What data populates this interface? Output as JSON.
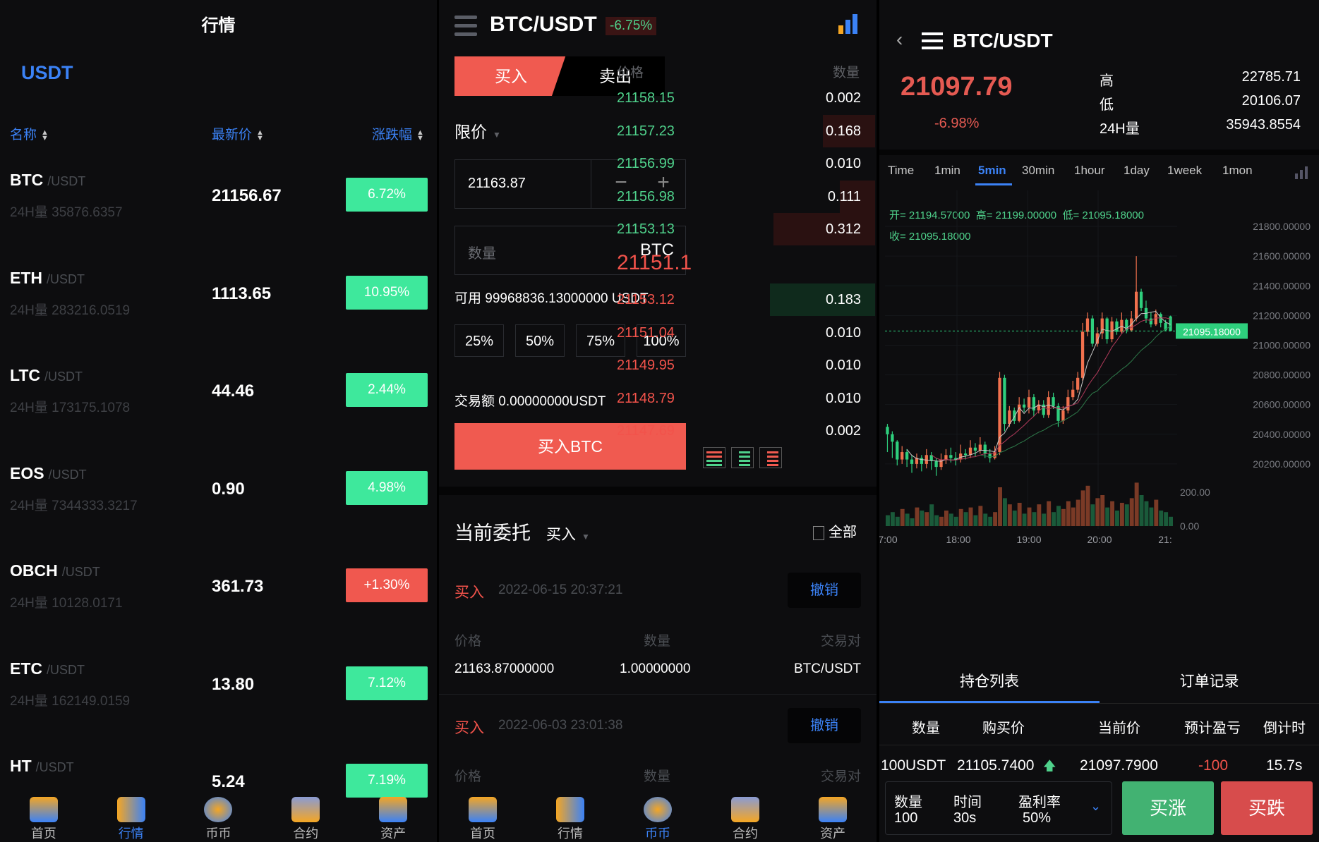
{
  "market": {
    "title": "行情",
    "quote_tab": "USDT",
    "headers": {
      "name": "名称",
      "price": "最新价",
      "change": "涨跌幅"
    },
    "rows": [
      {
        "sym": "BTC",
        "quote": "/USDT",
        "vol": "24H量 35876.6357",
        "price": "21156.67",
        "chg": "6.72%",
        "up": true
      },
      {
        "sym": "ETH",
        "quote": "/USDT",
        "vol": "24H量 283216.0519",
        "price": "1113.65",
        "chg": "10.95%",
        "up": true
      },
      {
        "sym": "LTC",
        "quote": "/USDT",
        "vol": "24H量 173175.1078",
        "price": "44.46",
        "chg": "2.44%",
        "up": true
      },
      {
        "sym": "EOS",
        "quote": "/USDT",
        "vol": "24H量 7344333.3217",
        "price": "0.90",
        "chg": "4.98%",
        "up": true
      },
      {
        "sym": "OBCH",
        "quote": "/USDT",
        "vol": "24H量 10128.0171",
        "price": "361.73",
        "chg": "+1.30%",
        "up": false
      },
      {
        "sym": "ETC",
        "quote": "/USDT",
        "vol": "24H量 162149.0159",
        "price": "13.80",
        "chg": "7.12%",
        "up": true
      },
      {
        "sym": "HT",
        "quote": "/USDT",
        "vol": "",
        "price": "5.24",
        "chg": "7.19%",
        "up": true
      }
    ]
  },
  "nav": {
    "home": "首页",
    "market": "行情",
    "coin": "币币",
    "contract": "合约",
    "assets": "资产"
  },
  "trade": {
    "pair": "BTC/USDT",
    "change": "-6.75%",
    "buy_tab": "买入",
    "sell_tab": "卖出",
    "order_type": "限价",
    "price_value": "21163.87",
    "qty_placeholder": "数量",
    "qty_unit": "BTC",
    "available": "可用 99968836.13000000 USDT",
    "pct": [
      "25%",
      "50%",
      "75%",
      "100%"
    ],
    "amount": "交易额 0.00000000USDT",
    "submit": "买入BTC",
    "ob_header": {
      "price": "价格",
      "qty": "数量"
    },
    "asks": [
      {
        "p": "21158.15",
        "q": "0.002",
        "depth": 0.0
      },
      {
        "p": "21157.23",
        "q": "0.168",
        "depth": 0.49
      },
      {
        "p": "21156.99",
        "q": "0.010",
        "depth": 0.0
      },
      {
        "p": "21156.98",
        "q": "0.111",
        "depth": 0.33
      },
      {
        "p": "21153.13",
        "q": "0.312",
        "depth": 0.95
      }
    ],
    "last": "21151.1",
    "bids": [
      {
        "p": "21153.12",
        "q": "0.183",
        "depth": 0.98
      },
      {
        "p": "21151.04",
        "q": "0.010",
        "depth": 0.0
      },
      {
        "p": "21149.95",
        "q": "0.010",
        "depth": 0.0
      },
      {
        "p": "21148.79",
        "q": "0.010",
        "depth": 0.0
      },
      {
        "p": "21147.69",
        "q": "0.002",
        "depth": 0.0
      }
    ],
    "orders_title": "当前委托",
    "orders_filter": "买入",
    "orders_all": "全部",
    "orders": [
      {
        "side": "买入",
        "time": "2022-06-15 20:37:21",
        "cancel": "撤销",
        "h_price": "价格",
        "h_qty": "数量",
        "h_pair": "交易对",
        "price": "21163.87000000",
        "qty": "1.00000000",
        "pair": "BTC/USDT"
      },
      {
        "side": "买入",
        "time": "2022-06-03 23:01:38",
        "cancel": "撤销",
        "h_price": "价格",
        "h_qty": "数量",
        "h_pair": "交易对"
      }
    ]
  },
  "chart": {
    "pair": "BTC/USDT",
    "price": "21097.79",
    "change": "-6.98%",
    "stats": {
      "high_l": "高",
      "high": "22785.71",
      "low_l": "低",
      "low": "20106.07",
      "vol_l": "24H量",
      "vol": "35943.8554"
    },
    "timeframes": [
      "Time",
      "1min",
      "5min",
      "30min",
      "1hour",
      "1day",
      "1week",
      "1mon"
    ],
    "active_tf": "5min",
    "ohlc_line1": "开= 21194.57000  高= 21199.00000  低= 21095.18000",
    "ohlc_line2": "收= 21095.18000",
    "current_label": "21095.18000",
    "tabs": {
      "positions": "持仓列表",
      "orders": "订单记录"
    },
    "pos_headers": {
      "qty": "数量",
      "buy": "购买价",
      "cur": "当前价",
      "pnl": "预计盈亏",
      "cd": "倒计时"
    },
    "pos_row": {
      "qty": "100USDT",
      "buy": "21105.7400",
      "cur": "21097.7900",
      "pnl": "-100",
      "cd": "15.7s"
    },
    "bottom": {
      "qty_l": "数量",
      "qty": "100",
      "time_l": "时间",
      "time": "30s",
      "rate_l": "盈利率",
      "rate": "50%",
      "up_btn": "买涨",
      "down_btn": "买跌"
    }
  },
  "chart_data": {
    "type": "candlestick",
    "y_ticks": [
      "21800.00000",
      "21600.00000",
      "21400.00000",
      "21200.00000",
      "21000.00000",
      "20800.00000",
      "20600.00000",
      "20400.00000",
      "20200.00000"
    ],
    "vol_ticks": [
      "200.00",
      "0.00"
    ],
    "x_ticks": [
      "7:00",
      "18:00",
      "19:00",
      "20:00",
      "21:"
    ],
    "ylim": [
      20000,
      21900
    ],
    "vol_max": 300,
    "candles": [
      [
        20450,
        20400,
        20470,
        20280
      ],
      [
        20400,
        20350,
        20420,
        20240
      ],
      [
        20350,
        20230,
        20360,
        20190
      ],
      [
        20230,
        20280,
        20320,
        20200
      ],
      [
        20280,
        20230,
        20300,
        20180
      ],
      [
        20230,
        20200,
        20260,
        20140
      ],
      [
        20200,
        20240,
        20270,
        20170
      ],
      [
        20240,
        20200,
        20260,
        20150
      ],
      [
        20200,
        20260,
        20300,
        20170
      ],
      [
        20260,
        20220,
        20280,
        20160
      ],
      [
        20220,
        20180,
        20240,
        20120
      ],
      [
        20180,
        20230,
        20270,
        20160
      ],
      [
        20230,
        20260,
        20300,
        20200
      ],
      [
        20260,
        20240,
        20310,
        20210
      ],
      [
        20240,
        20230,
        20280,
        20190
      ],
      [
        20230,
        20270,
        20330,
        20210
      ],
      [
        20270,
        20260,
        20300,
        20230
      ],
      [
        20260,
        20310,
        20360,
        20240
      ],
      [
        20310,
        20290,
        20340,
        20250
      ],
      [
        20290,
        20330,
        20380,
        20270
      ],
      [
        20330,
        20270,
        20350,
        20240
      ],
      [
        20270,
        20240,
        20300,
        20210
      ],
      [
        20240,
        20280,
        20320,
        20230
      ],
      [
        20280,
        20780,
        20820,
        20260
      ],
      [
        20780,
        20470,
        20800,
        20420
      ],
      [
        20470,
        20560,
        20590,
        20450
      ],
      [
        20560,
        20490,
        20580,
        20470
      ],
      [
        20490,
        20600,
        20650,
        20480
      ],
      [
        20600,
        20580,
        20640,
        20550
      ],
      [
        20580,
        20650,
        20700,
        20540
      ],
      [
        20650,
        20560,
        20670,
        20520
      ],
      [
        20560,
        20600,
        20630,
        20540
      ],
      [
        20600,
        20530,
        20630,
        20510
      ],
      [
        20530,
        20650,
        20690,
        20510
      ],
      [
        20650,
        20590,
        20680,
        20570
      ],
      [
        20590,
        20490,
        20610,
        20450
      ],
      [
        20490,
        20560,
        20590,
        20470
      ],
      [
        20560,
        20650,
        20700,
        20540
      ],
      [
        20650,
        20700,
        20760,
        20630
      ],
      [
        20700,
        20780,
        20820,
        20680
      ],
      [
        20780,
        21090,
        21150,
        20760
      ],
      [
        21090,
        21180,
        21220,
        21060
      ],
      [
        21180,
        21010,
        21200,
        20990
      ],
      [
        21010,
        21080,
        21120,
        20990
      ],
      [
        21080,
        21180,
        21220,
        21040
      ],
      [
        21180,
        21040,
        21190,
        21010
      ],
      [
        21040,
        21160,
        21190,
        21020
      ],
      [
        21160,
        21090,
        21180,
        21070
      ],
      [
        21090,
        21170,
        21220,
        21080
      ],
      [
        21170,
        21100,
        21180,
        21080
      ],
      [
        21100,
        21180,
        21230,
        21090
      ],
      [
        21180,
        21360,
        21600,
        21160
      ],
      [
        21360,
        21250,
        21380,
        21230
      ],
      [
        21250,
        21180,
        21300,
        21150
      ],
      [
        21180,
        21140,
        21220,
        21120
      ],
      [
        21140,
        21210,
        21240,
        21130
      ],
      [
        21210,
        21150,
        21220,
        21120
      ],
      [
        21150,
        21100,
        21170,
        21095
      ],
      [
        21194,
        21095,
        21199,
        21095
      ]
    ],
    "volumes": [
      70,
      90,
      60,
      110,
      80,
      50,
      120,
      100,
      90,
      140,
      70,
      60,
      100,
      80,
      60,
      110,
      90,
      120,
      70,
      130,
      80,
      60,
      90,
      250,
      180,
      140,
      100,
      150,
      80,
      120,
      90,
      140,
      80,
      160,
      90,
      130,
      110,
      160,
      120,
      170,
      230,
      260,
      140,
      180,
      200,
      120,
      160,
      100,
      150,
      140,
      180,
      280,
      200,
      160,
      120,
      170,
      100,
      90,
      60
    ]
  }
}
